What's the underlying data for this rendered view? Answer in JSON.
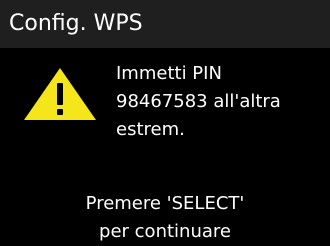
{
  "header": {
    "title": "Config. WPS"
  },
  "warning": {
    "icon": "warning-icon",
    "icon_color": "#f5e61b"
  },
  "message": {
    "line1": "Immetti PIN",
    "line2": "98467583 all'altra",
    "line3": "estrem."
  },
  "prompt": {
    "line1": "Premere 'SELECT'",
    "line2": "per continuare"
  }
}
